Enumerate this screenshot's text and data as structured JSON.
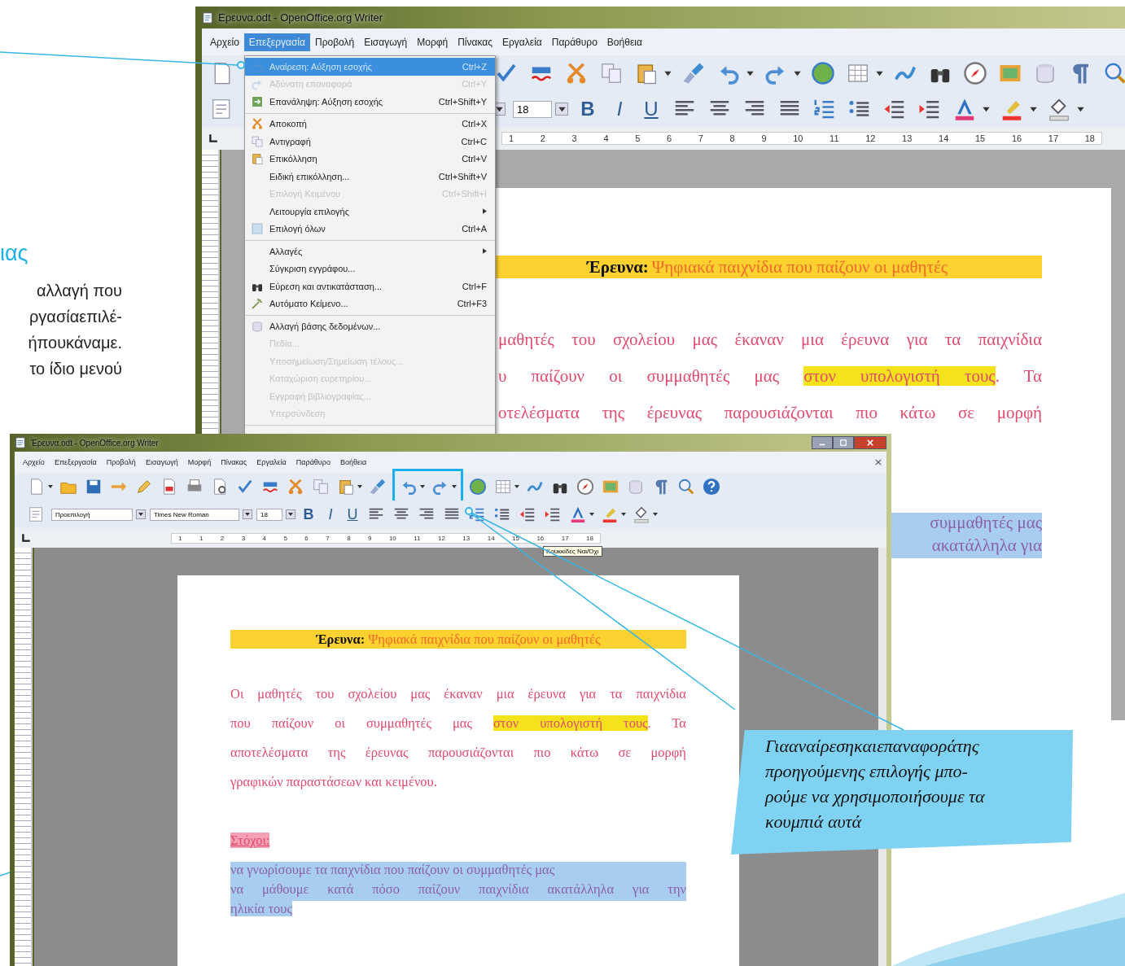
{
  "left_column": {
    "heading": "ιας",
    "lines": [
      "αλλαγή που",
      "ργασίαεπιλέ-",
      "ήπουκάναμε.",
      "το ίδιο μενού"
    ]
  },
  "windows": [
    {
      "title": "Ερευνα.odt - OpenOffice.org Writer",
      "menu": [
        {
          "label": "Αρχείο",
          "selected": false
        },
        {
          "label": "Επεξεργασία",
          "selected": true
        },
        {
          "label": "Προβολή",
          "selected": false
        },
        {
          "label": "Εισαγωγή",
          "selected": false
        },
        {
          "label": "Μορφή",
          "selected": false
        },
        {
          "label": "Πίνακας",
          "selected": false
        },
        {
          "label": "Εργαλεία",
          "selected": false
        },
        {
          "label": "Παράθυρο",
          "selected": false
        },
        {
          "label": "Βοήθεια",
          "selected": false
        }
      ],
      "dropdown": [
        [
          {
            "label": "Αναίρεση: Αύξηση εσοχής",
            "shortcut": "Ctrl+Z",
            "disabled": false,
            "selected": true,
            "submenu": false
          },
          {
            "label": "Αδύνατη επαναφορά",
            "shortcut": "Ctrl+Y",
            "disabled": true,
            "selected": false,
            "submenu": false
          },
          {
            "label": "Επανάληψη: Αύξηση εσοχής",
            "shortcut": "Ctrl+Shift+Y",
            "disabled": false,
            "selected": false,
            "submenu": false
          }
        ],
        [
          {
            "label": "Αποκοπή",
            "shortcut": "Ctrl+X",
            "disabled": false,
            "selected": false,
            "submenu": false
          },
          {
            "label": "Αντιγραφή",
            "shortcut": "Ctrl+C",
            "disabled": false,
            "selected": false,
            "submenu": false
          },
          {
            "label": "Επικόλληση",
            "shortcut": "Ctrl+V",
            "disabled": false,
            "selected": false,
            "submenu": false
          },
          {
            "label": "Ειδική επικόλληση...",
            "shortcut": "Ctrl+Shift+V",
            "disabled": false,
            "selected": false,
            "submenu": false
          },
          {
            "label": "Επιλογή Κειμένου",
            "shortcut": "Ctrl+Shift+I",
            "disabled": true,
            "selected": false,
            "submenu": false
          },
          {
            "label": "Λειτουργία επιλογής",
            "disabled": false,
            "selected": false,
            "submenu": true
          },
          {
            "label": "Επιλογή όλων",
            "shortcut": "Ctrl+A",
            "disabled": false,
            "selected": false,
            "submenu": false
          }
        ],
        [
          {
            "label": "Αλλαγές",
            "disabled": false,
            "selected": false,
            "submenu": true
          },
          {
            "label": "Σύγκριση εγγράφου...",
            "disabled": false,
            "selected": false,
            "submenu": false
          },
          {
            "label": "Εύρεση και αντικατάσταση...",
            "shortcut": "Ctrl+F",
            "disabled": false,
            "selected": false,
            "submenu": false
          },
          {
            "label": "Αυτόματο Κείμενο...",
            "shortcut": "Ctrl+F3",
            "disabled": false,
            "selected": false,
            "submenu": false
          }
        ],
        [
          {
            "label": "Αλλαγή βάσης δεδομένων...",
            "disabled": false,
            "selected": false,
            "submenu": false
          },
          {
            "label": "Πεδία...",
            "disabled": true,
            "selected": false,
            "submenu": false
          },
          {
            "label": "Υποσημείωση/Σημείωση τέλους...",
            "disabled": true,
            "selected": false,
            "submenu": false
          },
          {
            "label": "Καταχώριση ευρετηρίου...",
            "disabled": true,
            "selected": false,
            "submenu": false
          },
          {
            "label": "Εγγραφή βιβλιογραφίας...",
            "disabled": true,
            "selected": false,
            "submenu": false
          },
          {
            "label": "Υπερσύνδεση",
            "disabled": true,
            "selected": false,
            "submenu": false
          }
        ]
      ],
      "font_fields": [
        "18"
      ],
      "format_buttons": [
        "B",
        "I",
        "U"
      ],
      "ruler_labels": [
        "1",
        "2",
        "3",
        "4",
        "5",
        "6",
        "7",
        "8",
        "9",
        "10",
        "11",
        "12",
        "13",
        "14",
        "15",
        "16",
        "17",
        "18"
      ],
      "document": {
        "heading_label": "Έρευνα:",
        "heading_title": "Ψηφιακά παιχνίδια που παίζουν οι μαθητές",
        "lines": [
          {
            "kind": "body",
            "justified": true,
            "segments": [
              {
                "text": "μαθητές του σχολείου μας έκαναν μια έρευνα για τα παιχνίδια",
                "highlight": false
              }
            ]
          },
          {
            "kind": "body",
            "justified": true,
            "segments": [
              {
                "text": "υ παίζουν οι συμμαθητές μας ",
                "highlight": false
              },
              {
                "text": "στον υπολογιστή τους",
                "highlight": true
              },
              {
                "text": ". Τα",
                "highlight": false
              }
            ]
          },
          {
            "kind": "body",
            "justified": true,
            "segments": [
              {
                "text": "οτελέσματα της έρευνας παρουσιάζονται πιο κάτω σε μορφή",
                "highlight": false
              }
            ]
          },
          {
            "kind": "blank"
          },
          {
            "kind": "blank"
          },
          {
            "kind": "fragment",
            "text": "συμμαθητές μας"
          },
          {
            "kind": "fragment",
            "text": "ακατάλληλα για"
          }
        ]
      }
    },
    {
      "title": "Έρευνα.odt - OpenOffice.org Writer",
      "menu": [
        {
          "label": "Αρχείο",
          "selected": false
        },
        {
          "label": "Επεξεργασία",
          "selected": false
        },
        {
          "label": "Προβολή",
          "selected": false
        },
        {
          "label": "Εισαγωγή",
          "selected": false
        },
        {
          "label": "Μορφή",
          "selected": false
        },
        {
          "label": "Πίνακας",
          "selected": false
        },
        {
          "label": "Εργαλεία",
          "selected": false
        },
        {
          "label": "Παράθυρο",
          "selected": false
        },
        {
          "label": "Βοήθεια",
          "selected": false
        }
      ],
      "font_fields": [
        "Προεπιλογή",
        "Times New Roman",
        "18"
      ],
      "format_buttons": [
        "B",
        "I",
        "U"
      ],
      "ruler_labels": [
        "1",
        "1",
        "2",
        "3",
        "4",
        "5",
        "6",
        "7",
        "8",
        "9",
        "10",
        "11",
        "12",
        "13",
        "14",
        "15",
        "16",
        "17",
        "18"
      ],
      "tooltip": "Κουκκίδες Ναι/Όχι",
      "document": {
        "heading_label": "Έρευνα:",
        "heading_title": "Ψηφιακά παιχνίδια που παίζουν οι μαθητές",
        "lines": [
          {
            "kind": "blank"
          },
          {
            "kind": "body",
            "justified": true,
            "segments": [
              {
                "text": "Οι μαθητές του σχολείου μας έκαναν μια έρευνα για τα παιχνίδια",
                "highlight": false
              }
            ]
          },
          {
            "kind": "body",
            "justified": true,
            "segments": [
              {
                "text": "που παίζουν οι συμμαθητές μας ",
                "highlight": false
              },
              {
                "text": "στον υπολογιστή τους",
                "highlight": true
              },
              {
                "text": ". Τα",
                "highlight": false
              }
            ]
          },
          {
            "kind": "body",
            "justified": true,
            "segments": [
              {
                "text": "αποτελέσματα της έρευνας παρουσιάζονται πιο κάτω σε μορφή",
                "highlight": false
              }
            ]
          },
          {
            "kind": "body",
            "justified": false,
            "segments": [
              {
                "text": "γραφικών παραστάσεων και κειμένου.",
                "highlight": false
              }
            ]
          },
          {
            "kind": "blank"
          },
          {
            "kind": "label",
            "text": "Στόχοι:"
          },
          {
            "kind": "goal",
            "justified": false,
            "text": "να γνωρίσουμε τα παιχνίδια που παίζουν οι συμμαθητές μας"
          },
          {
            "kind": "goal",
            "justified": true,
            "text": "να μάθουμε κατά πόσο παίζουν παιχνίδια ακατάλληλα για την"
          },
          {
            "kind": "goal-end",
            "justified": false,
            "text": "ηλικία τους"
          }
        ]
      }
    }
  ],
  "callout": {
    "lines": [
      "Γιααναίρεσηκαιεπαναφοράτης",
      "προηγούμενης επιλογής μπο-",
      "ρούμε να χρησιμοποιήσουμε τα",
      "κουμπιά αυτά"
    ]
  }
}
